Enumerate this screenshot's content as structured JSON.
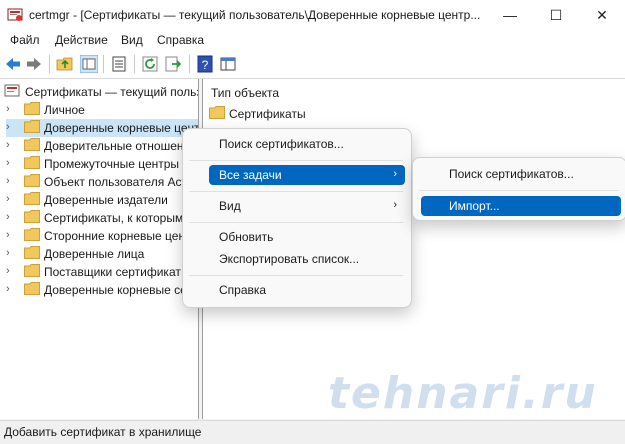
{
  "window": {
    "title": "certmgr - [Сертификаты — текущий пользователь\\Доверенные корневые центр...",
    "minimize": "—",
    "maximize": "☐",
    "close": "✕"
  },
  "menubar": [
    "Файл",
    "Действие",
    "Вид",
    "Справка"
  ],
  "toolbar": {
    "icons": [
      "back-icon",
      "forward-icon",
      "up-folder-icon",
      "show-tree-icon",
      "properties-icon",
      "refresh-icon",
      "export-icon",
      "help-icon",
      "console-view-icon"
    ]
  },
  "tree": {
    "root": "Сертификаты — текущий польз",
    "items": [
      "Личное",
      "Доверенные корневые цент",
      "Доверительные отношен",
      "Промежуточные центры",
      "Объект пользователя Act",
      "Доверенные издатели",
      "Сертификаты, к которым",
      "Сторонние корневые цен",
      "Доверенные лица",
      "Поставщики сертификат",
      "Доверенные корневые се"
    ]
  },
  "right_pane": {
    "column_header": "Тип объекта",
    "items": [
      "Сертификаты"
    ]
  },
  "context_menu": {
    "items": [
      "Поиск сертификатов...",
      "Все задачи",
      "Вид",
      "Обновить",
      "Экспортировать список...",
      "Справка"
    ]
  },
  "submenu": {
    "items": [
      "Поиск сертификатов...",
      "Импорт..."
    ]
  },
  "status": {
    "text": "Добавить сертификат в хранилище"
  },
  "watermark": "tehnari.ru",
  "colors": {
    "highlight": "#0067c0",
    "tree_selection": "#cce4f7",
    "folder": "#f2c75c"
  }
}
